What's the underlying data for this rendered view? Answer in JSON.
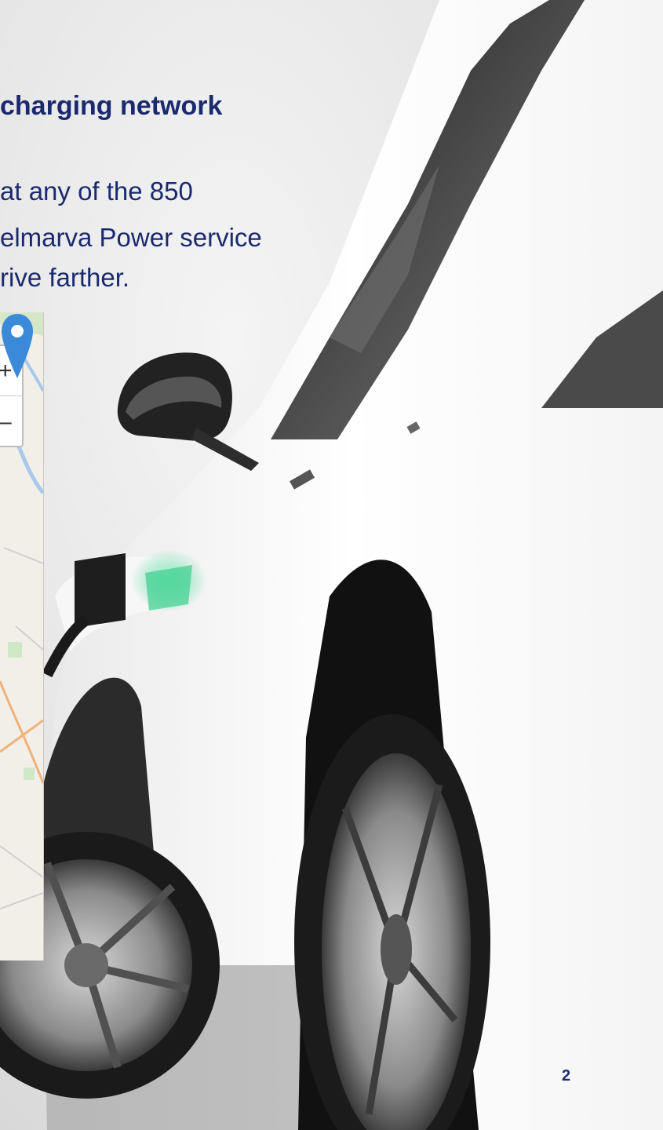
{
  "slide": {
    "heading": "charging network",
    "body_lines": [
      "at any of the 850",
      "elmarva Power service",
      "rive farther."
    ],
    "page_number": "2"
  },
  "map": {
    "zoom_in_label": "+",
    "zoom_out_label": "–",
    "marker_icon": "location-pin-icon",
    "marker_color": "#3b8ad9"
  },
  "colors": {
    "text": "#1a2a6e",
    "charger_glow": "#3ccf8e"
  }
}
